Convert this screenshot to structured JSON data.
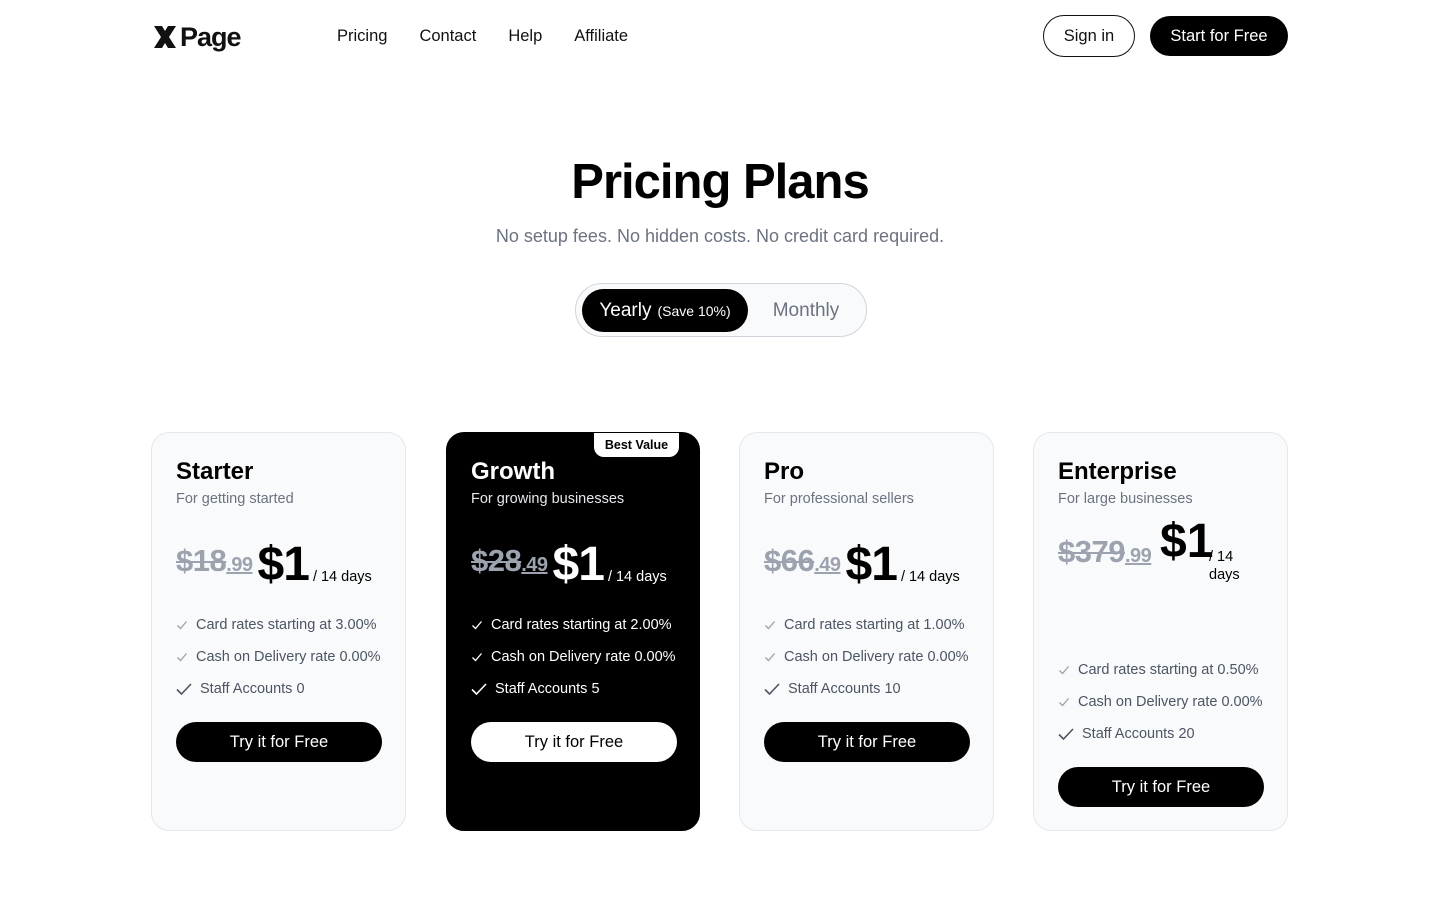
{
  "header": {
    "logo_text": "Page",
    "nav": [
      "Pricing",
      "Contact",
      "Help",
      "Affiliate"
    ],
    "signin_label": "Sign in",
    "start_label": "Start for Free"
  },
  "hero": {
    "title": "Pricing Plans",
    "subtitle": "No setup fees. No hidden costs. No credit card required."
  },
  "billing_toggle": {
    "yearly_label": "Yearly",
    "yearly_note": "(Save 10%)",
    "monthly_label": "Monthly",
    "selected": "Yearly"
  },
  "plans": [
    {
      "name": "Starter",
      "desc": "For getting started",
      "old_price_main": "$18",
      "old_price_cents": ".99",
      "price": "$1",
      "period": "/ 14 days",
      "features": [
        "Card rates starting at 3.00%",
        "Cash on Delivery rate 0.00%",
        "Staff Accounts 0"
      ],
      "cta": "Try it for Free"
    },
    {
      "name": "Growth",
      "desc": "For growing businesses",
      "badge": "Best Value",
      "old_price_main": "$28",
      "old_price_cents": ".49",
      "price": "$1",
      "period": "/ 14 days",
      "features": [
        "Card rates starting at 2.00%",
        "Cash on Delivery rate 0.00%",
        "Staff Accounts 5"
      ],
      "cta": "Try it for Free"
    },
    {
      "name": "Pro",
      "desc": "For professional sellers",
      "old_price_main": "$66",
      "old_price_cents": ".49",
      "price": "$1",
      "period": "/ 14 days",
      "features": [
        "Card rates starting at 1.00%",
        "Cash on Delivery rate 0.00%",
        "Staff Accounts 10"
      ],
      "cta": "Try it for Free"
    },
    {
      "name": "Enterprise",
      "desc": "For large businesses",
      "old_price_main": "$379",
      "old_price_cents": ".99",
      "price": "$1",
      "period": "/ 14 days",
      "features": [
        "Card rates starting at 0.50%",
        "Cash on Delivery rate 0.00%",
        "Staff Accounts 20"
      ],
      "cta": "Try it for Free"
    }
  ]
}
